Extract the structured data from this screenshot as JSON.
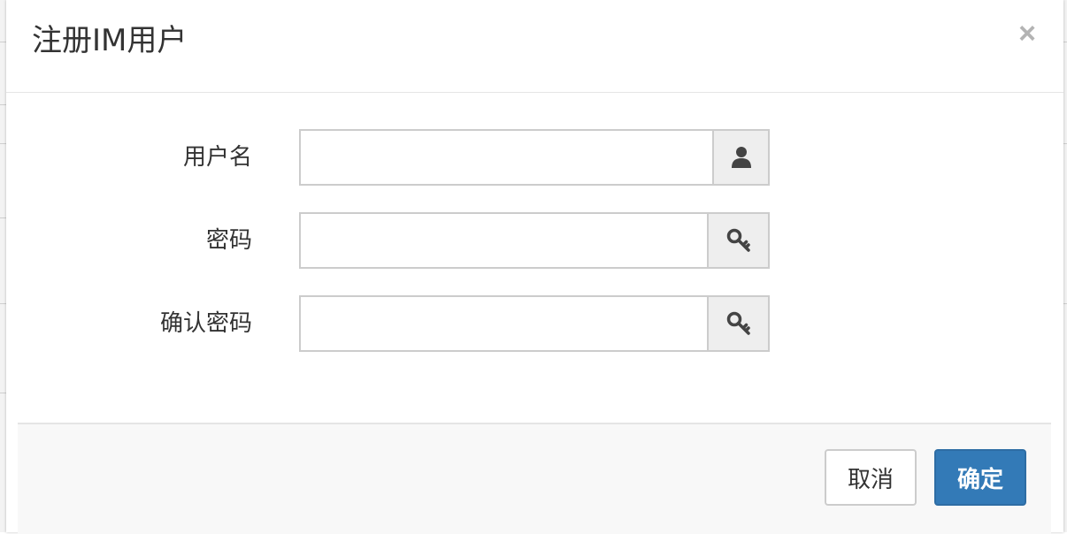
{
  "modal": {
    "title": "注册IM用户",
    "close_label": "×"
  },
  "form": {
    "fields": [
      {
        "label": "用户名",
        "value": "",
        "icon": "user-icon"
      },
      {
        "label": "密码",
        "value": "",
        "icon": "key-icon"
      },
      {
        "label": "确认密码",
        "value": "",
        "icon": "key-icon"
      }
    ]
  },
  "footer": {
    "cancel_label": "取消",
    "ok_label": "确定"
  },
  "colors": {
    "primary": "#337ab7",
    "icon": "#444444",
    "addon_bg": "#eeeeee",
    "border": "#cccccc"
  }
}
